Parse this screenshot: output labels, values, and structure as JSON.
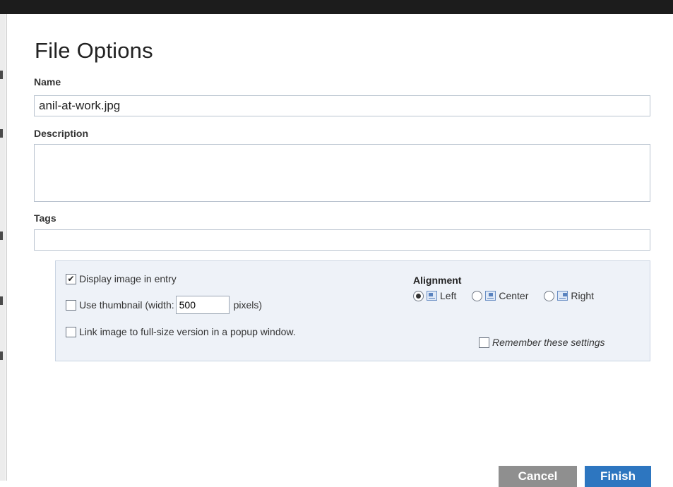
{
  "dialog": {
    "title": "File Options",
    "name_label": "Name",
    "name_value": "anil-at-work.jpg",
    "description_label": "Description",
    "description_value": "",
    "tags_label": "Tags",
    "tags_value": ""
  },
  "options": {
    "display_image": {
      "label": "Display image in entry",
      "checked": true
    },
    "use_thumbnail": {
      "label_before": "Use thumbnail (width:",
      "width_value": "500",
      "label_after": "pixels)",
      "checked": false
    },
    "link_popup": {
      "label": "Link image to full-size version in a popup window.",
      "checked": false
    },
    "alignment": {
      "title": "Alignment",
      "selected": "Left",
      "choices": [
        {
          "label": "Left",
          "icon": "align-left-icon"
        },
        {
          "label": "Center",
          "icon": "align-center-icon"
        },
        {
          "label": "Right",
          "icon": "align-right-icon"
        }
      ]
    },
    "remember": {
      "label": "Remember these settings",
      "checked": false
    }
  },
  "buttons": {
    "cancel": "Cancel",
    "finish": "Finish"
  },
  "colors": {
    "accent": "#2d76c0",
    "cancel_bg": "#8f8f8f",
    "options_bg": "#eef2f8",
    "topbar": "#1c1c1c"
  }
}
